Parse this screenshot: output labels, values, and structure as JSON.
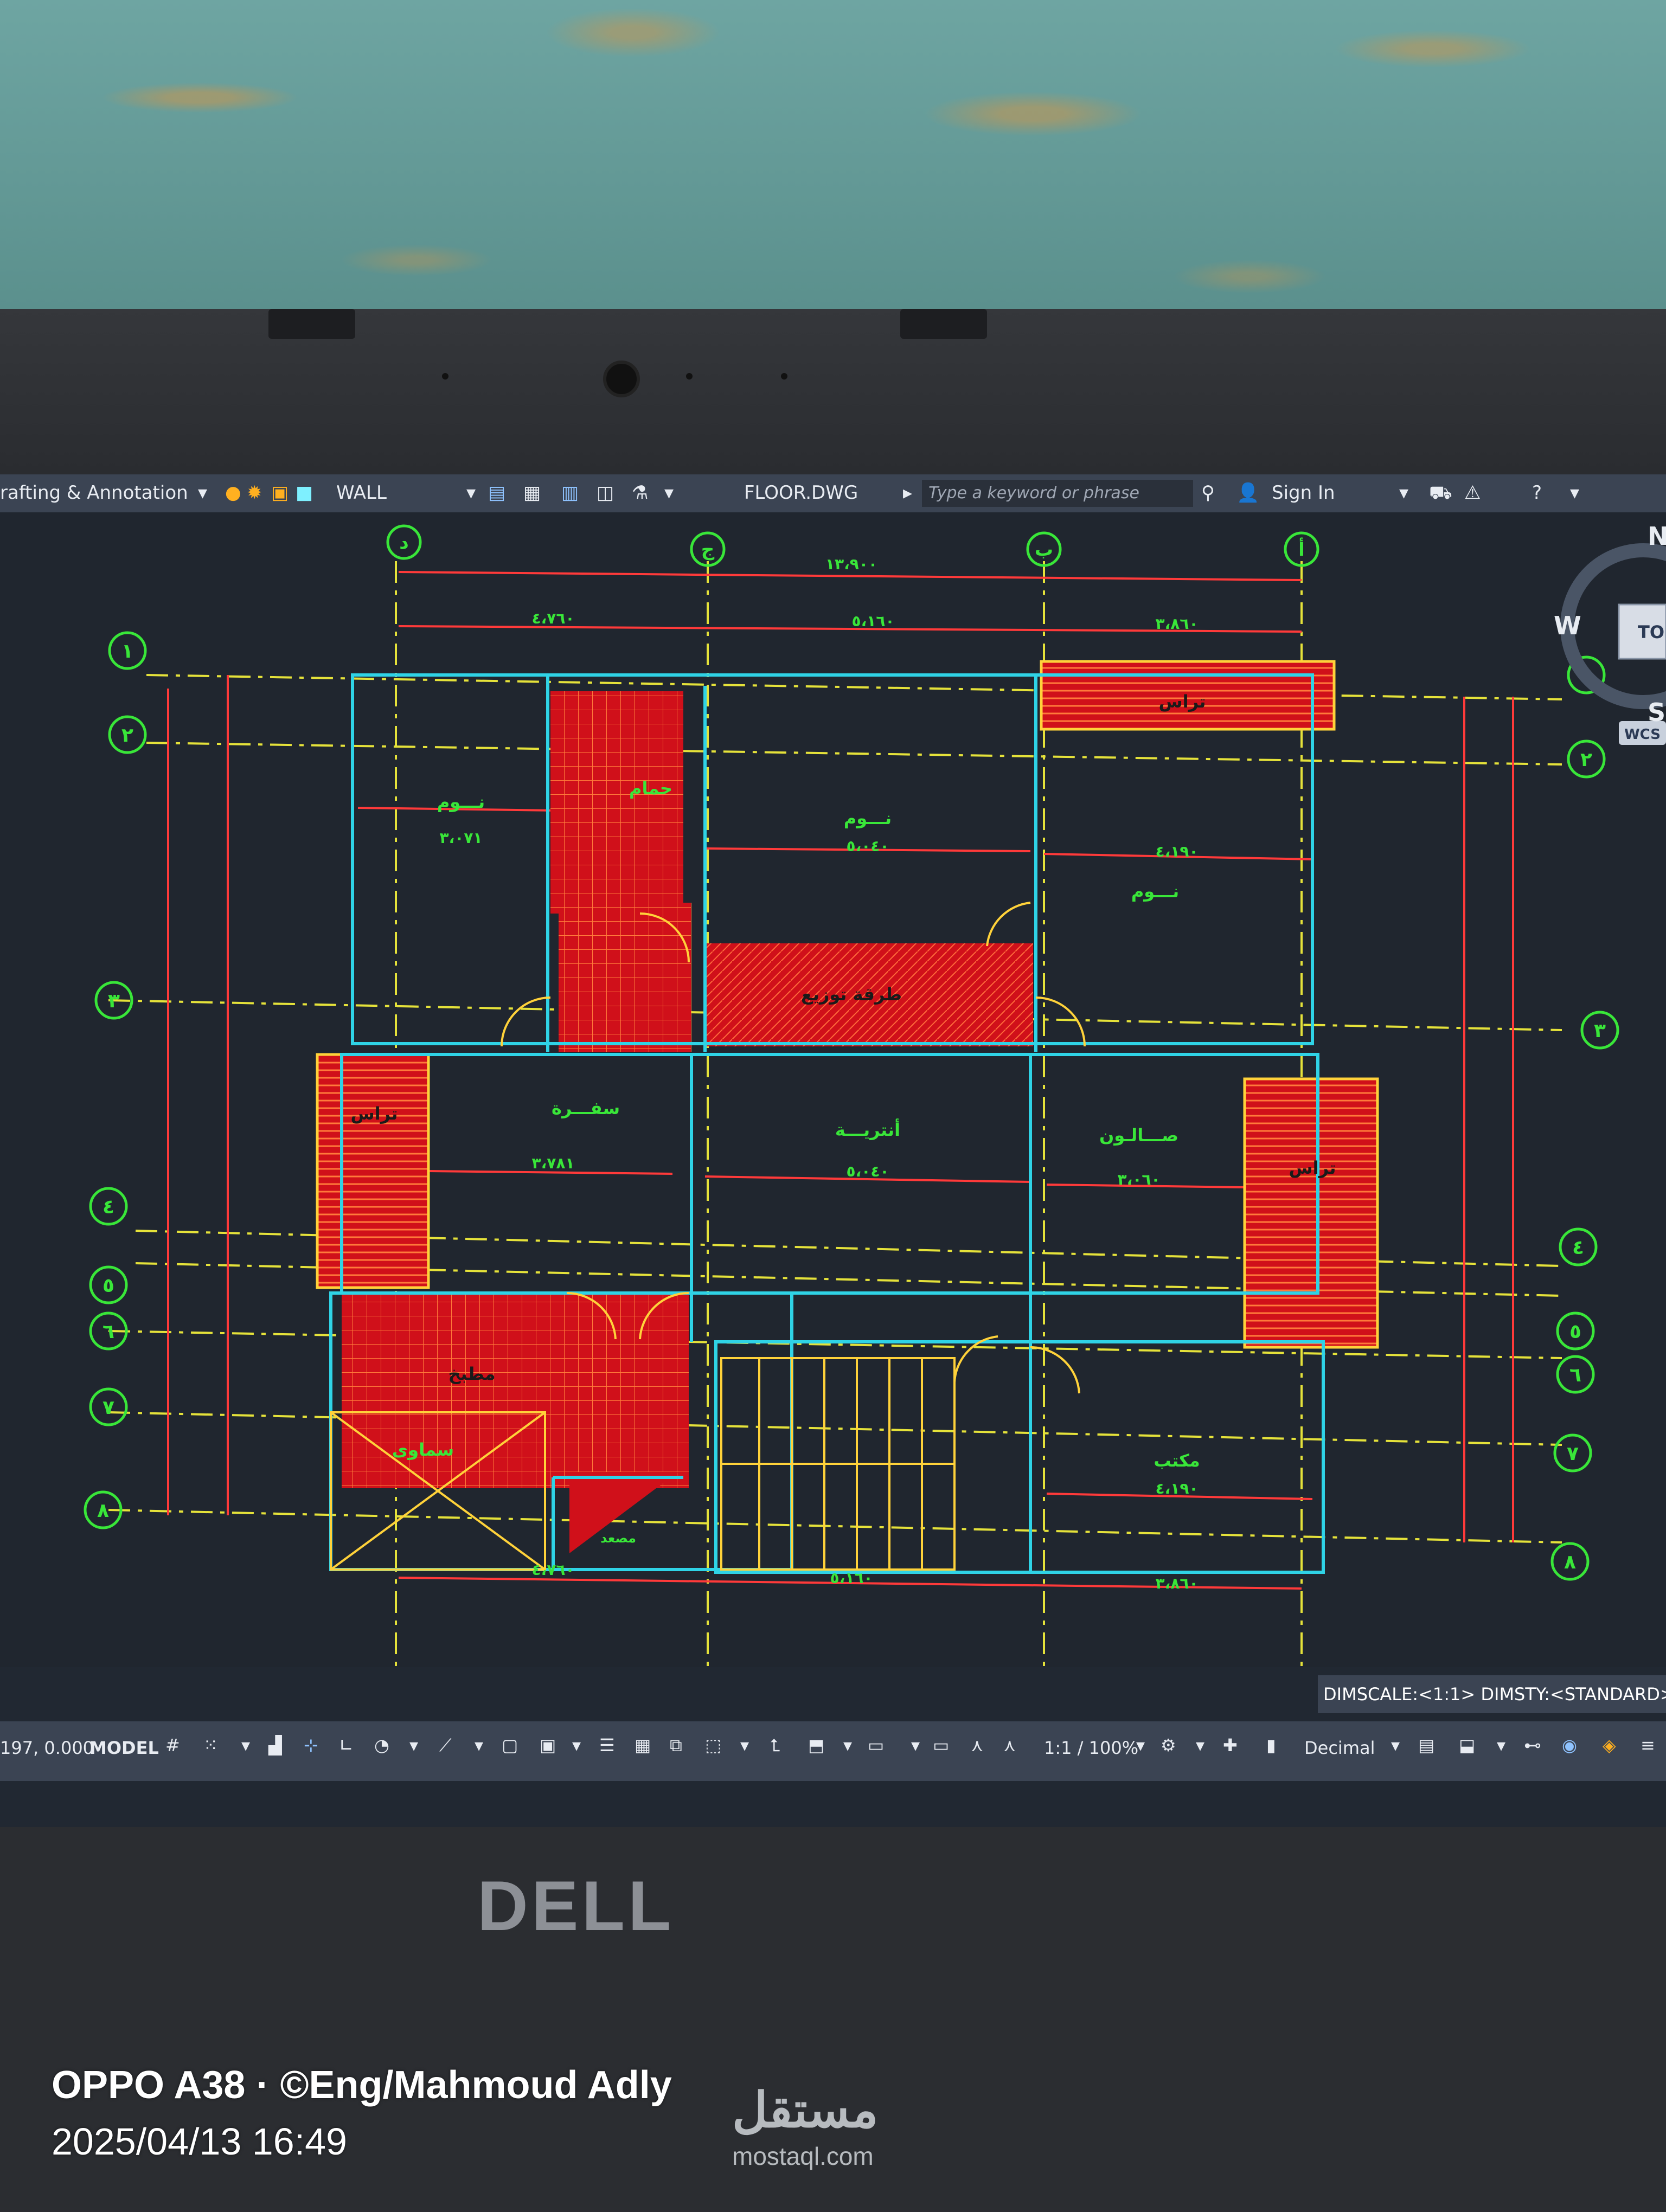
{
  "toolbar": {
    "workspace": "rafting & Annotation",
    "layer": "WALL",
    "file": "FLOOR.DWG",
    "search_placeholder": "Type a keyword or phrase",
    "sign_in": "Sign In"
  },
  "viewcube": {
    "north": "N",
    "west": "W",
    "south": "S",
    "top": "TO",
    "wcs": "WCS"
  },
  "status": {
    "coords": "197, 0.000",
    "model": "MODEL",
    "scale": "1:1 / 100%",
    "units": "Decimal",
    "dimscale": "DIMSCALE:<1:1> DIMSTY:<STANDARD>"
  },
  "grid": {
    "columns": [
      "د",
      "ج",
      "ب",
      "أ"
    ],
    "rows": [
      "١",
      "٢",
      "٣",
      "٤",
      "٥",
      "٦",
      "٧",
      "٨"
    ]
  },
  "rooms": {
    "bed1": "نـــوم",
    "bath": "حمام",
    "bed2": "نـــوم",
    "terrace_top": "تراس",
    "bed3": "نـــوم",
    "corridor": "طرقة توزيع",
    "terrace_left": "تراس",
    "dining": "سفـــرة",
    "living": "أنتريـــة",
    "salon": "صـــالـون",
    "terrace_right": "تراس",
    "kitchen": "مطبخ",
    "office": "مكتب",
    "skylight": "سماوى",
    "elevator": "مصعد"
  },
  "dims": {
    "total_top": "١٣،٩٠٠",
    "top_a": "٤،٧٦٠",
    "top_b": "٥،١٦٠",
    "top_c": "٣،٨٦٠",
    "bed1_w": "٣،٠٧١",
    "bed2_w": "٥،٠٤٠",
    "bed3_w": "٤،١٩٠",
    "dining_w": "٣،٧٨١",
    "living_w": "٥،٠٤٠",
    "salon_w": "٣،٠٦٠",
    "office_w": "٤،١٩٠",
    "bottom_a": "٤،٧٦٠",
    "bottom_b": "٥،١٦٠",
    "bottom_c": "٣،٨٦٠"
  },
  "device": {
    "brand": "DELL"
  },
  "watermark": {
    "line1": "OPPO A38 · ©Eng/Mahmoud Adly",
    "line2": "2025/04/13 16:49",
    "logo": "مستقل",
    "logo_url": "mostaql.com"
  },
  "colors": {
    "canvas": "#20262f",
    "wall": "#2fd3e6",
    "hatch": "#e0101c",
    "grid_line": "#e5e23a",
    "dim_line": "#ff3a3a",
    "bubble": "#39e639",
    "accent_text": "#39e639"
  }
}
